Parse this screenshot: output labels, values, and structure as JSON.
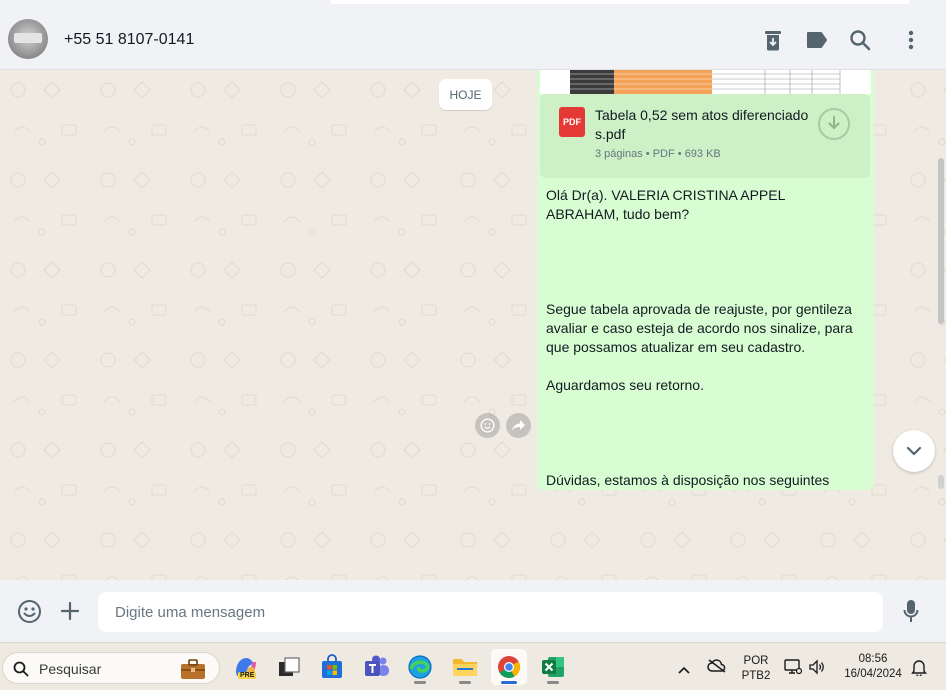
{
  "contact": {
    "name": "+55 51 8107-0141"
  },
  "header_icons": [
    "archive-icon",
    "label-icon",
    "search-icon",
    "menu-icon"
  ],
  "chat": {
    "date_label": "HOJE",
    "document": {
      "file_name": "Tabela 0,52 sem atos diferenciado s.pdf",
      "badge": "PDF",
      "pages": "3 páginas",
      "type": "PDF",
      "size": "693 KB"
    },
    "messages": [
      "Olá Dr(a). VALERIA CRISTINA APPEL ABRAHAM, tudo bem?",
      "Segue tabela aprovada de reajuste, por gentileza avaliar e caso esteja de acordo nos sinalize, para que possamos atualizar em seu cadastro.",
      "Aguardamos seu retorno.",
      "Dúvidas, estamos à disposição nos seguintes"
    ]
  },
  "compose": {
    "placeholder": "Digite uma mensagem"
  },
  "taskbar": {
    "search_label": "Pesquisar",
    "language_line1": "POR",
    "language_line2": "PTB2",
    "time": "08:56",
    "date": "16/04/2024",
    "copilot_badge": "PRE"
  },
  "colors": {
    "outgoing_bubble": "#d9fdd3",
    "chat_background": "#efeae2",
    "header_background": "#f0f2f5",
    "pdf_red": "#e53935"
  }
}
